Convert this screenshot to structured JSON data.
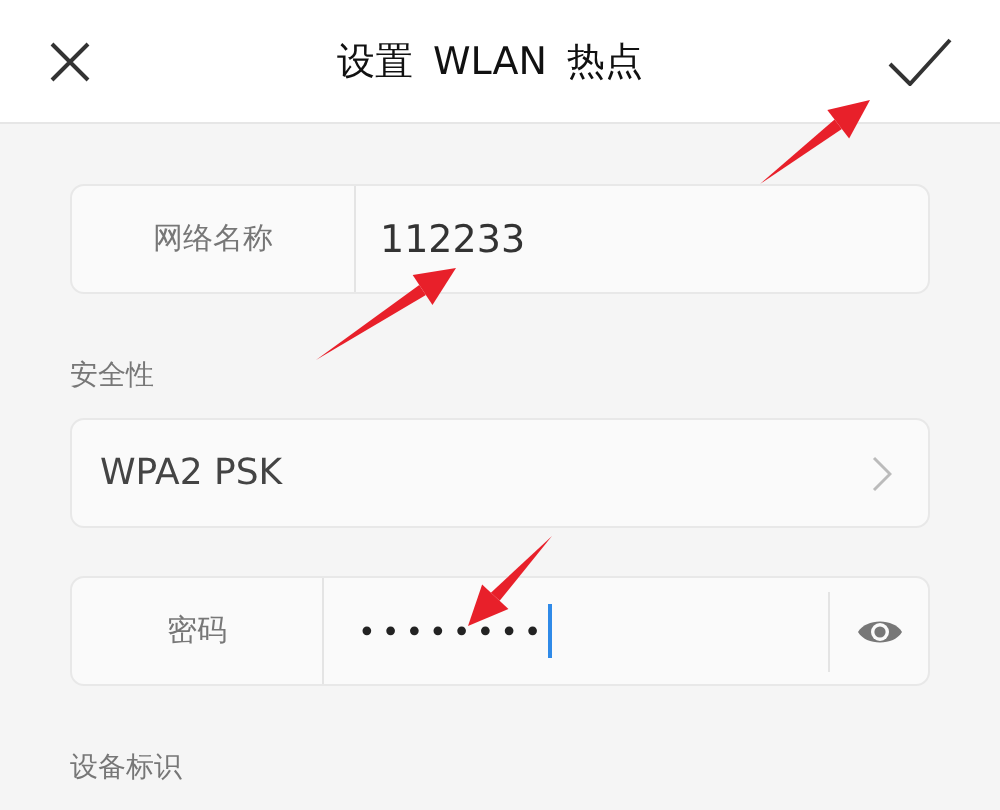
{
  "header": {
    "title": "设置 WLAN 热点"
  },
  "fields": [
    {
      "kind": "text",
      "label": "网络名称",
      "value": "112233"
    },
    {
      "kind": "section",
      "label": "安全性"
    },
    {
      "kind": "select",
      "value": "WPA2 PSK"
    },
    {
      "kind": "password",
      "label": "密码",
      "value": "••••••••",
      "focused": true
    },
    {
      "kind": "section",
      "label": "设备标识"
    }
  ]
}
